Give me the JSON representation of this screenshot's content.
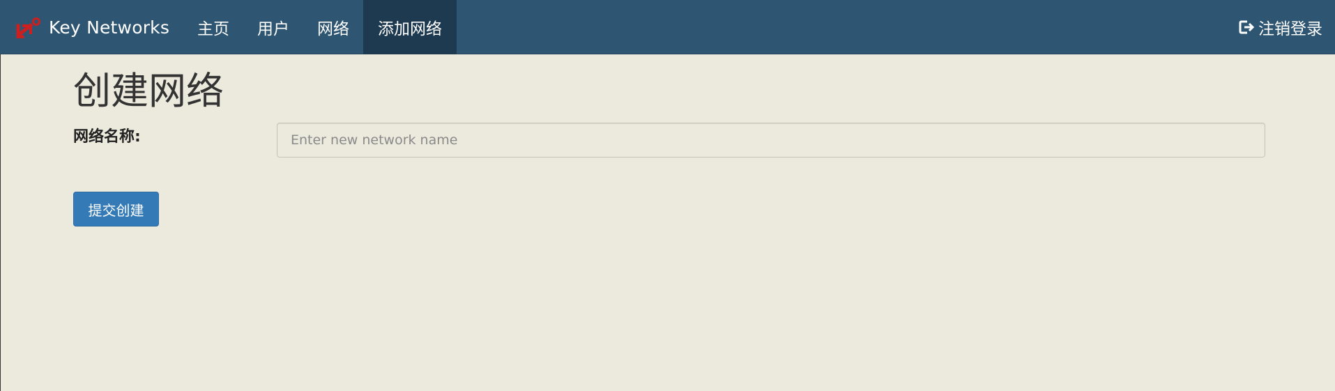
{
  "navbar": {
    "brand": "Key Networks",
    "brand_icon": "key-network-logo-icon",
    "items": [
      {
        "label": "主页",
        "active": false
      },
      {
        "label": "用户",
        "active": false
      },
      {
        "label": "网络",
        "active": false
      },
      {
        "label": "添加网络",
        "active": true
      }
    ],
    "logout": {
      "label": "注销登录",
      "icon": "logout-icon"
    }
  },
  "main": {
    "title": "创建网络",
    "form": {
      "name_label": "网络名称:",
      "name_value": "",
      "name_placeholder": "Enter new network name",
      "submit_label": "提交创建"
    }
  },
  "colors": {
    "navbar": "#2e5571",
    "navbar_active": "#1e3a50",
    "background": "#ece9dd",
    "button": "#337ab7",
    "logo": "#cc1f1f"
  }
}
